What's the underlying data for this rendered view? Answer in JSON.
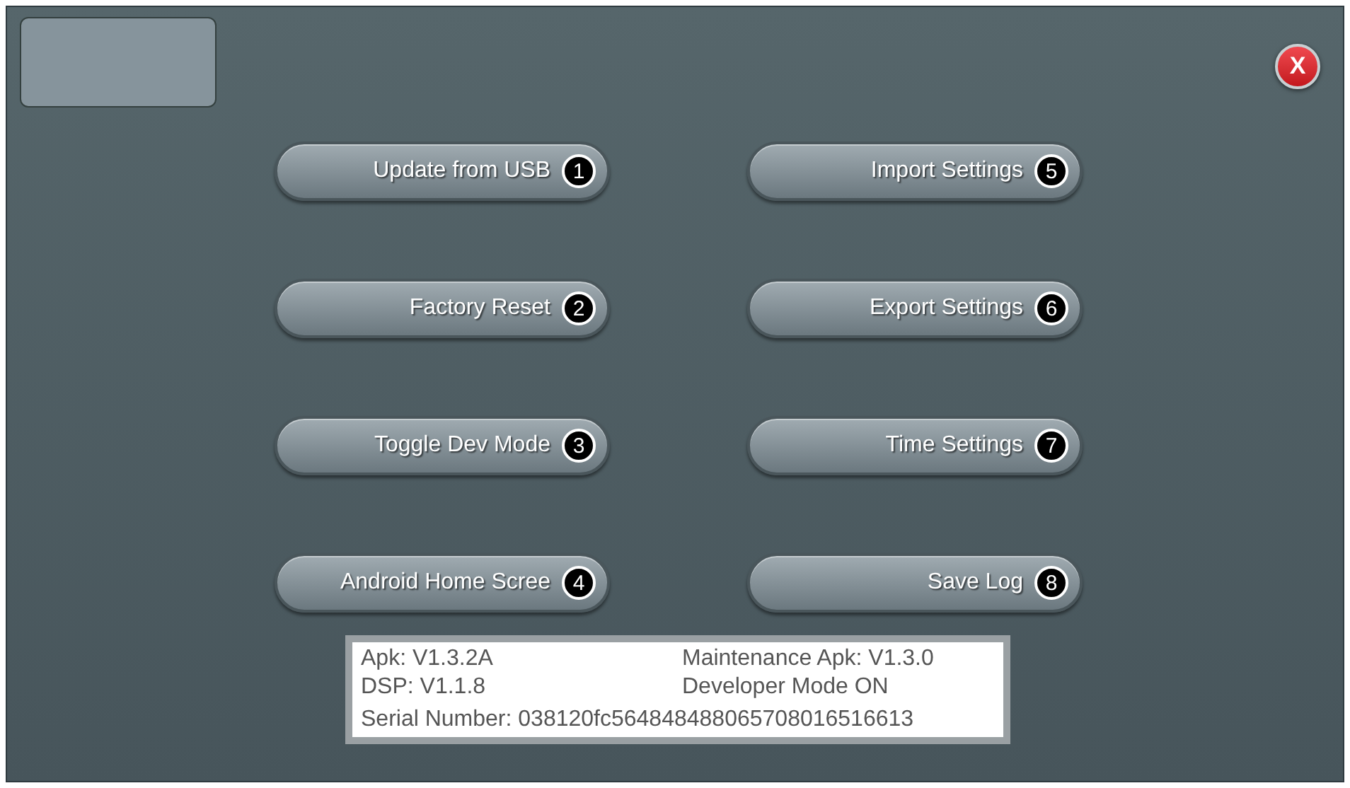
{
  "close_button": {
    "label": "X"
  },
  "buttons": [
    {
      "label": "Update from USB",
      "marker": "1"
    },
    {
      "label": "Import Settings",
      "marker": "5"
    },
    {
      "label": "Factory Reset",
      "marker": "2"
    },
    {
      "label": "Export Settings",
      "marker": "6"
    },
    {
      "label": "Toggle Dev Mode",
      "marker": "3"
    },
    {
      "label": "Time Settings",
      "marker": "7"
    },
    {
      "label": "Android Home Scree",
      "marker": "4"
    },
    {
      "label": "Save Log",
      "marker": "8"
    }
  ],
  "info": {
    "rows": [
      [
        "Apk: V1.3.2A",
        "Maintenance Apk: V1.3.0"
      ],
      [
        "DSP: V1.1.8",
        "Developer Mode ON"
      ]
    ],
    "serial": "Serial Number: 038120fc564848488065708016516613"
  }
}
